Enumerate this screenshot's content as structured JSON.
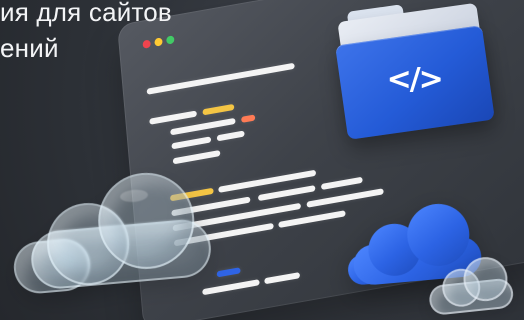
{
  "hero": {
    "line1": "ия для сайтов",
    "line2": "ений"
  },
  "icons": {
    "folder": "code-folder-icon",
    "window_controls": [
      "red-dot-icon",
      "yellow-dot-icon",
      "green-dot-icon"
    ],
    "clouds": [
      "glass-cloud-icon",
      "blue-cloud-icon",
      "small-glass-cloud-icon"
    ]
  },
  "colors": {
    "background": "#2d3138",
    "window": "#3e4249",
    "folder_blue": "#245bd7",
    "accent_yellow": "#f4c544",
    "accent_orange": "#ff7b55",
    "accent_blue": "#2f64e6"
  },
  "folder": {
    "symbol": "</>"
  }
}
